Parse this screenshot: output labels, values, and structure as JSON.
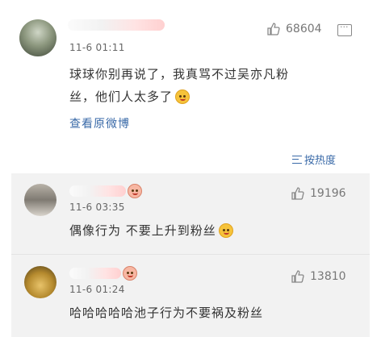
{
  "comments": [
    {
      "time": "11-6 01:11",
      "likes": "68604",
      "text_line1": "球球你别再说了，我真骂不过吴亦凡粉",
      "text_line2": "丝，他们人太多了",
      "view_original": "查看原微博"
    },
    {
      "time": "11-6 03:35",
      "likes": "19196",
      "text": "偶像行为 不要上升到粉丝"
    },
    {
      "time": "11-6 01:24",
      "likes": "13810",
      "text": "哈哈哈哈哈池子行为不要祸及粉丝"
    }
  ],
  "sort_label": "按热度",
  "icons": {
    "like": "thumbs-up-icon",
    "reply": "comment-icon",
    "sort": "sort-icon",
    "emoji": "doge-emoji-icon"
  },
  "colors": {
    "link": "#3a6aa8",
    "sub_panel": "#f2f2f2",
    "text": "#333333",
    "muted": "#777777"
  }
}
